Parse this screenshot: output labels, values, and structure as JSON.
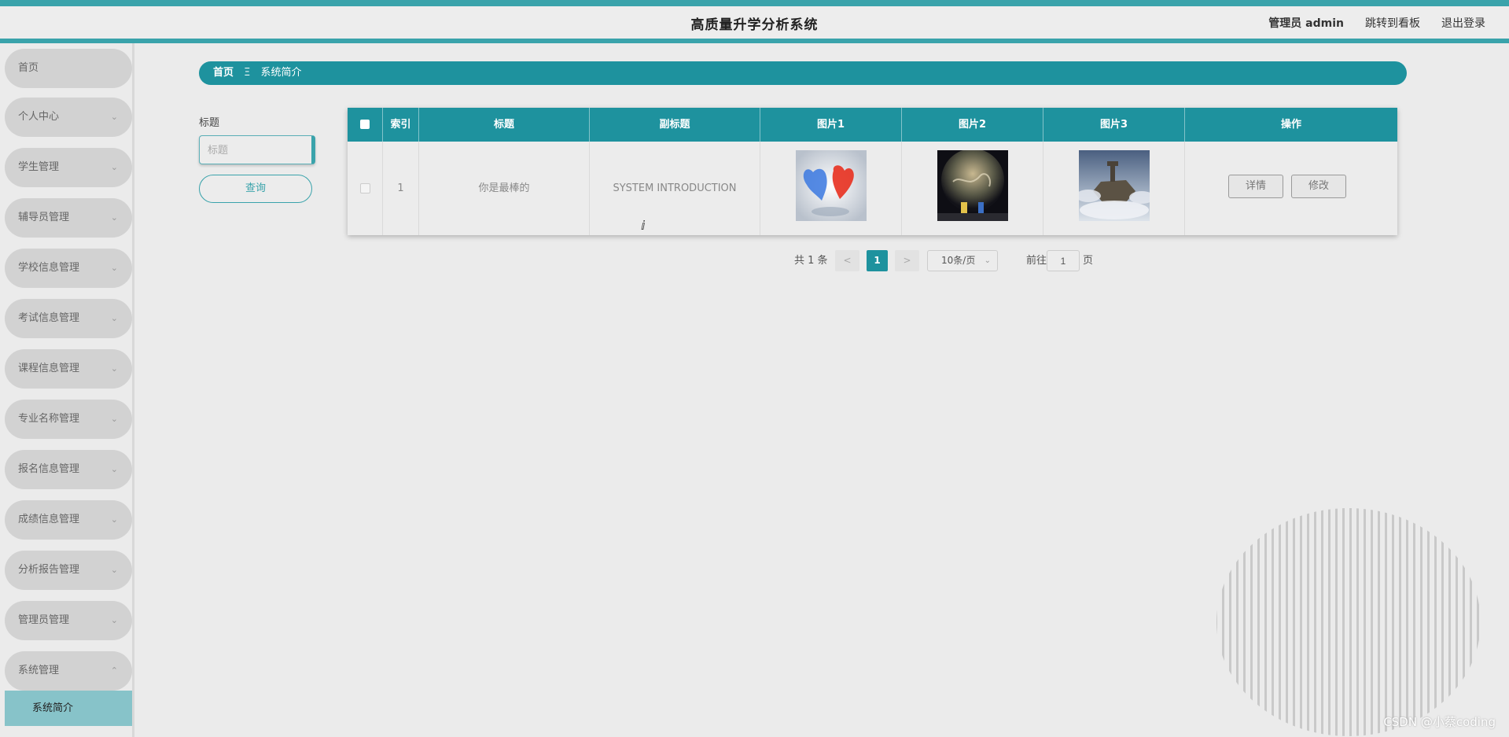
{
  "header": {
    "title": "高质量升学分析系统",
    "admin": "管理员 admin",
    "goto_board": "跳转到看板",
    "logout": "退出登录"
  },
  "sidebar": {
    "items": [
      {
        "label": "首页",
        "chevron": ""
      },
      {
        "label": "个人中心",
        "chevron": "chevron-down-icon"
      },
      {
        "label": "学生管理",
        "chevron": "chevron-down-icon"
      },
      {
        "label": "辅导员管理",
        "chevron": "chevron-down-icon"
      },
      {
        "label": "学校信息管理",
        "chevron": "chevron-down-icon"
      },
      {
        "label": "考试信息管理",
        "chevron": "chevron-down-icon"
      },
      {
        "label": "课程信息管理",
        "chevron": "chevron-down-icon"
      },
      {
        "label": "专业名称管理",
        "chevron": "chevron-down-icon"
      },
      {
        "label": "报名信息管理",
        "chevron": "chevron-down-icon"
      },
      {
        "label": "成绩信息管理",
        "chevron": "chevron-down-icon"
      },
      {
        "label": "分析报告管理",
        "chevron": "chevron-down-icon"
      },
      {
        "label": "管理员管理",
        "chevron": "chevron-down-icon"
      },
      {
        "label": "系统管理",
        "chevron": "chevron-up-icon"
      }
    ],
    "sub_item": "系统简介"
  },
  "breadcrumb": {
    "home": "首页",
    "separator": "Ξ",
    "current": "系统简介"
  },
  "search": {
    "label": "标题",
    "placeholder": "标题",
    "button": "查询"
  },
  "table": {
    "headers": {
      "index": "索引",
      "title": "标题",
      "subtitle": "副标题",
      "img1": "图片1",
      "img2": "图片2",
      "img3": "图片3",
      "actions": "操作"
    },
    "rows": [
      {
        "index": "1",
        "title": "你是最棒的",
        "subtitle": "SYSTEM INTRODUCTION",
        "detail_btn": "详情",
        "edit_btn": "修改"
      }
    ]
  },
  "pagination": {
    "total": "共 1 条",
    "prev": "<",
    "current_page": "1",
    "next": ">",
    "page_size": "10条/页",
    "goto_label": "前往",
    "goto_value": "1",
    "goto_unit": "页"
  },
  "colors": {
    "accent": "#1e929e",
    "accent_light": "#3aa3ab",
    "submenu_active": "#87c3c9",
    "menu_item_bg": "#d2d2d2"
  },
  "watermark": "CSDN @小蔡coding"
}
